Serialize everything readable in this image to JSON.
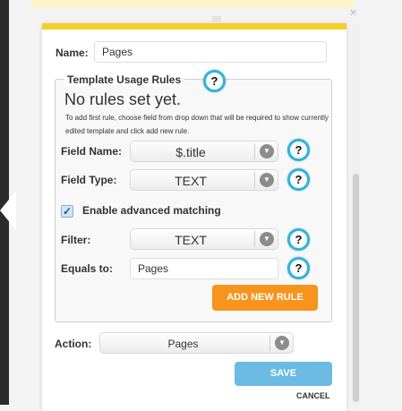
{
  "form": {
    "name_label": "Name:",
    "name_value": "Pages",
    "section_title": "Template Usage Rules",
    "no_rules_title": "No rules set yet.",
    "no_rules_hint": "To add first rule, choose field from drop down that will be required to show currently edited template and click add new rule.",
    "field_name_label": "Field Name:",
    "field_name_value": "$.title",
    "field_type_label": "Field Type:",
    "field_type_value": "TEXT",
    "advanced_label": "Enable advanced matching",
    "advanced_checked": true,
    "filter_label": "Filter:",
    "filter_value": "TEXT",
    "equals_label": "Equals to:",
    "equals_value": "Pages",
    "add_rule_label": "ADD NEW RULE",
    "action_label": "Action:",
    "action_value": "Pages",
    "save_label": "SAVE",
    "cancel_label": "CANCEL"
  },
  "icons": {
    "help_glyph": "?",
    "dropdown_glyph": "▼",
    "close_glyph": "✕",
    "check_glyph": "✓"
  },
  "colors": {
    "header_accent": "#f6cf2a",
    "help_ring": "#2db4e0",
    "add_button": "#f7941d",
    "save_button": "#6bbbe3"
  }
}
